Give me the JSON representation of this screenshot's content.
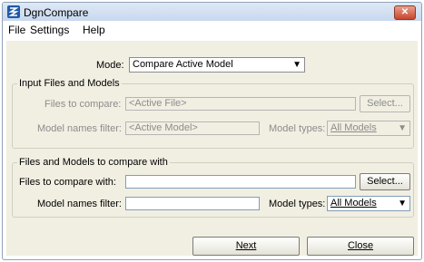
{
  "window": {
    "title": "DgnCompare",
    "close_glyph": "✕"
  },
  "menu": [
    {
      "label": "File"
    },
    {
      "label": "Settings"
    },
    {
      "label": "Help"
    }
  ],
  "mode": {
    "label": "Mode:",
    "value": "Compare Active Model"
  },
  "input_group": {
    "title": "Input Files and Models",
    "files_label": "Files to compare:",
    "files_value": "<Active File>",
    "select_button": "Select...",
    "model_filter_label": "Model names filter:",
    "model_filter_value": "<Active Model>",
    "model_types_label": "Model types:",
    "model_types_value": "All Models"
  },
  "compare_group": {
    "title": "Files and Models to compare with",
    "files_label": "Files to compare with:",
    "files_value": "",
    "select_button": "Select...",
    "model_filter_label": "Model names filter:",
    "model_filter_value": "",
    "model_types_label": "Model types:",
    "model_types_value": "All Models"
  },
  "buttons": {
    "next": "Next",
    "close": "Close"
  }
}
